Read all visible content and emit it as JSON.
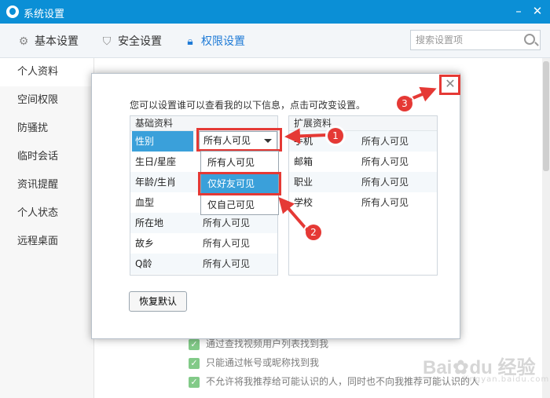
{
  "window": {
    "title": "系统设置",
    "minimize": "–",
    "close": "✕"
  },
  "tabs": [
    {
      "label": "基本设置",
      "icon": "gear-icon"
    },
    {
      "label": "安全设置",
      "icon": "shield-icon"
    },
    {
      "label": "权限设置",
      "icon": "lock-icon",
      "active": true
    }
  ],
  "search": {
    "placeholder": "搜索设置项"
  },
  "sidebar": {
    "items": [
      "个人资料",
      "空间权限",
      "防骚扰",
      "临时会话",
      "资讯提醒",
      "个人状态",
      "远程桌面"
    ]
  },
  "background_checks": [
    "通过查找视频用户列表找到我",
    "只能通过帐号或昵称找到我",
    "不允许将我推荐给可能认识的人，同时也不向我推荐可能认识的人"
  ],
  "dialog": {
    "intro": "您可以设置谁可以查看我的以下信息，点击可改变设置。",
    "close": "✕",
    "basic": {
      "header": "基础资料",
      "rows": [
        {
          "name": "性别",
          "value": ""
        },
        {
          "name": "生日/星座",
          "value": ""
        },
        {
          "name": "年龄/生肖",
          "value": ""
        },
        {
          "name": "血型",
          "value": ""
        },
        {
          "name": "所在地",
          "value": "所有人可见"
        },
        {
          "name": "故乡",
          "value": "所有人可见"
        },
        {
          "name": "Q龄",
          "value": "所有人可见"
        }
      ]
    },
    "extended": {
      "header": "扩展资料",
      "rows": [
        {
          "name": "手机",
          "value": "所有人可见"
        },
        {
          "name": "邮箱",
          "value": "所有人可见"
        },
        {
          "name": "职业",
          "value": "所有人可见"
        },
        {
          "name": "学校",
          "value": "所有人可见"
        }
      ]
    },
    "dropdown": {
      "selected": "所有人可见",
      "options": [
        "所有人可见",
        "仅好友可见",
        "仅自己可见"
      ]
    },
    "reset_label": "恢复默认"
  },
  "callouts": [
    "1",
    "2",
    "3"
  ],
  "watermark": {
    "text": "Bai",
    "suffix": "du",
    "cn": "经验",
    "sub": "jingyan.baidu.com"
  },
  "colors": {
    "titlebar": "#0b8fd6",
    "accent": "#1e7ad6",
    "selection": "#3aa0da",
    "callout": "#e53935",
    "check": "#3fae49"
  }
}
